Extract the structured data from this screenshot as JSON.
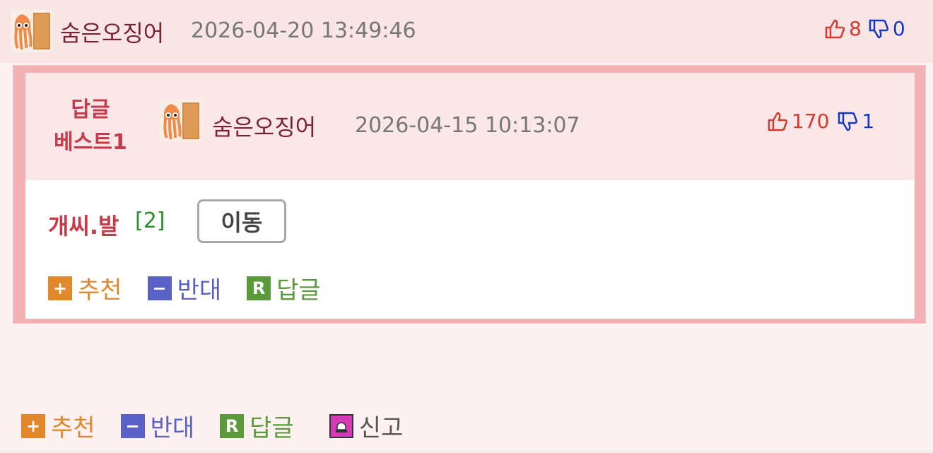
{
  "post": {
    "author": "숨은오징어",
    "timestamp": "2026-04-20 13:49:46",
    "up_count": "8",
    "down_count": "0"
  },
  "best_reply": {
    "label_line1": "답글",
    "label_line2": "베스트1",
    "author": "숨은오징어",
    "timestamp": "2026-04-15 10:13:07",
    "up_count": "170",
    "down_count": "1",
    "comment": "개씨.발",
    "reply_count": "[2]",
    "move_label": "이동",
    "actions": {
      "recommend": "추천",
      "oppose": "반대",
      "reply": "답글"
    }
  },
  "bottom_actions": {
    "recommend": "추천",
    "oppose": "반대",
    "reply": "답글",
    "report": "신고"
  },
  "icons": {
    "recommend": "plus-icon",
    "oppose": "minus-icon",
    "reply": "r-icon",
    "report": "siren-icon",
    "up": "thumbs-up-icon",
    "down": "thumbs-down-icon"
  },
  "colors": {
    "recommend": "#e0882b",
    "oppose": "#5a63c5",
    "reply": "#5a9a3b",
    "up": "#d43a2c",
    "down": "#1238c8",
    "best_border": "#f4b1b3"
  }
}
